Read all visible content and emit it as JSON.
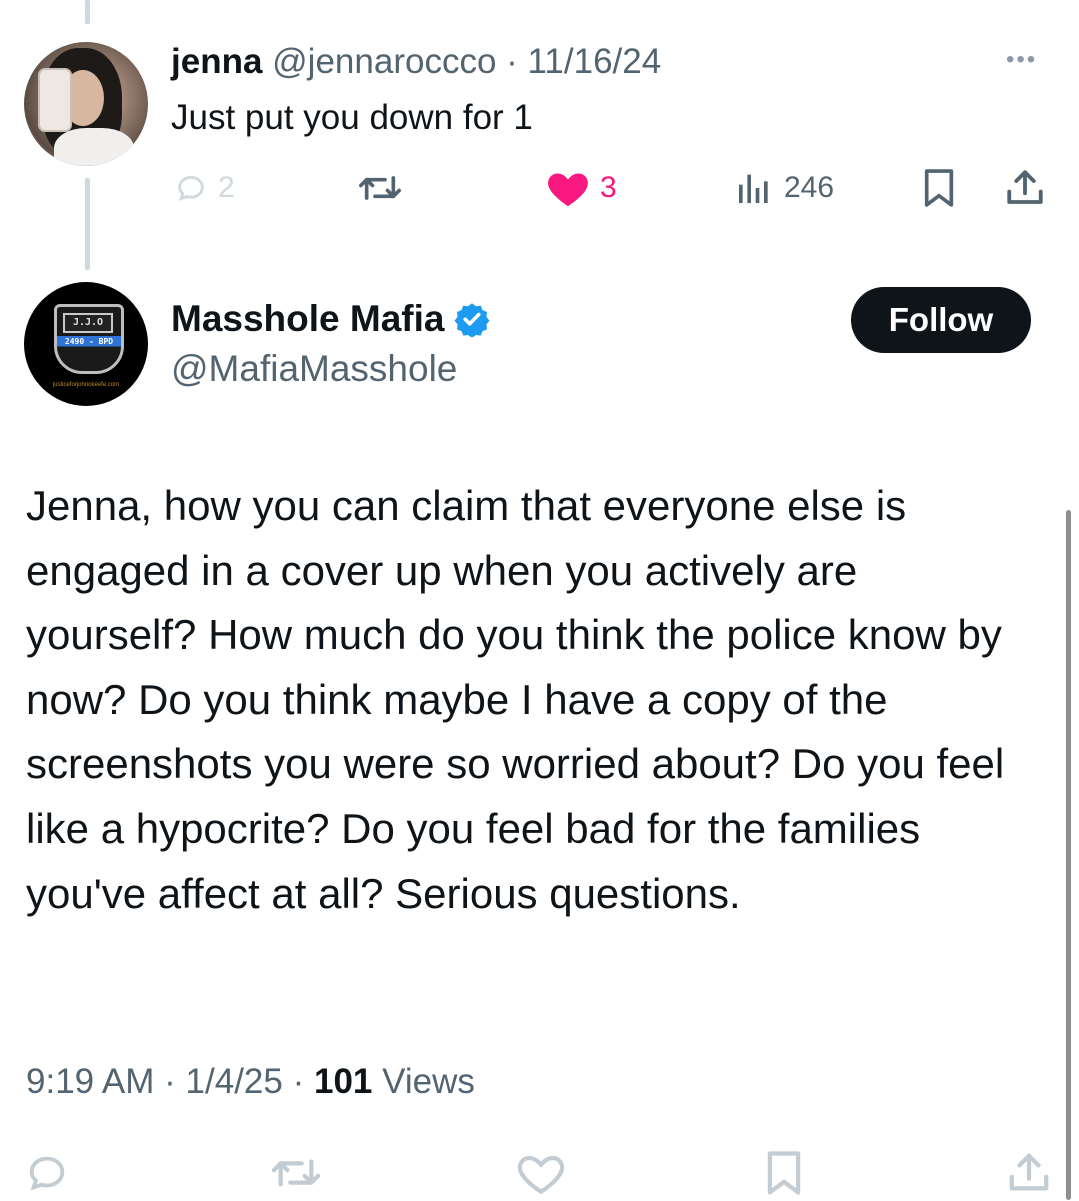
{
  "reply": {
    "author_name": "jenna",
    "author_handle": "@jennaroccco",
    "separator": "·",
    "date": "11/16/24",
    "text": "Just put you down for 1",
    "more_icon": "ellipsis-icon",
    "actions": {
      "replies": "2",
      "likes": "3",
      "views": "246"
    }
  },
  "tweet": {
    "author_name": "Masshole Mafia",
    "author_handle": "@MafiaMasshole",
    "verified_icon": "verified-badge-icon",
    "follow_label": "Follow",
    "avatar": {
      "badge_top": "J.J.O",
      "badge_mid": "2490 - BPD",
      "badge_url": "justiceforjohnokeefe.com"
    },
    "text": "Jenna, how you can claim that everyone else is engaged in a cover up when you actively are yourself? How much do you think the police know by now? Do you think maybe I have a copy of the screenshots you were so worried about? Do you feel like a hypocrite? Do you feel bad for the families you've affect at all? Serious questions.",
    "time": "9:19 AM",
    "separator": "·",
    "date": "1/4/25",
    "views_count": "101",
    "views_label": "Views"
  },
  "colors": {
    "text": "#0f1419",
    "secondary": "#536471",
    "like": "#f91880",
    "verified": "#1d9bf0",
    "follow_bg": "#0f1419"
  }
}
